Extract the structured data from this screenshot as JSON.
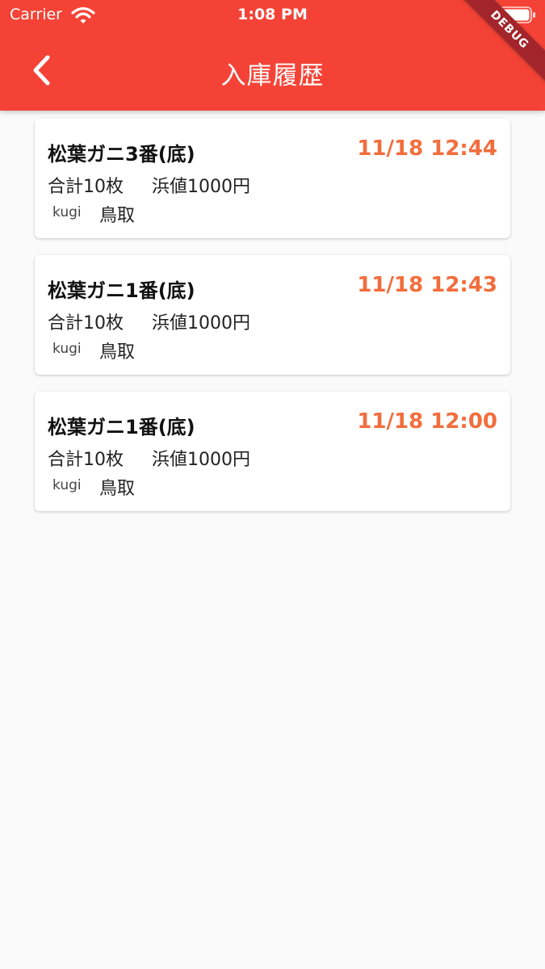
{
  "status_bar": {
    "carrier": "Carrier",
    "time": "1:08 PM",
    "icons": [
      "wifi-icon",
      "battery-icon"
    ]
  },
  "nav": {
    "title": "入庫履歴",
    "back_icon": "chevron-left-icon"
  },
  "debug_banner": "DEBUG",
  "colors": {
    "app_bar": "#f44336",
    "timestamp": "#f26d3d",
    "background": "#fafafa"
  },
  "entries": [
    {
      "name": "松葉ガニ3番(底)",
      "time": "11/18 12:44",
      "total": "合計10枚",
      "price": "浜値1000円",
      "user": "kugi",
      "location": "鳥取"
    },
    {
      "name": "松葉ガニ1番(底)",
      "time": "11/18 12:43",
      "total": "合計10枚",
      "price": "浜値1000円",
      "user": "kugi",
      "location": "鳥取"
    },
    {
      "name": "松葉ガニ1番(底)",
      "time": "11/18 12:00",
      "total": "合計10枚",
      "price": "浜値1000円",
      "user": "kugi",
      "location": "鳥取"
    }
  ]
}
